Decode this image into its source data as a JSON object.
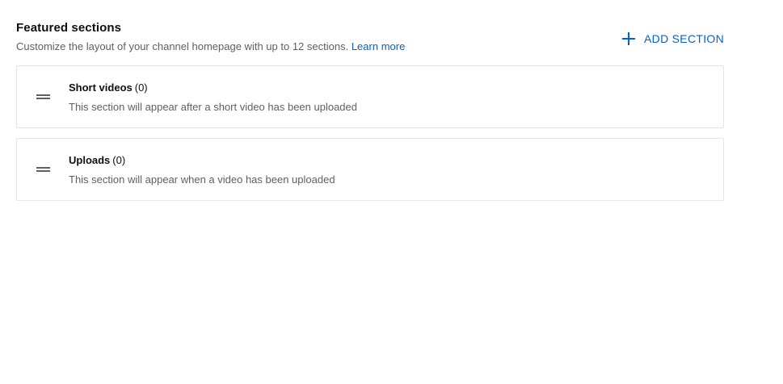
{
  "header": {
    "title": "Featured sections",
    "subtitle": "Customize the layout of your channel homepage with up to 12 sections.",
    "learn_more": "Learn more",
    "add_section_label": "ADD SECTION",
    "add_icon": "plus-icon"
  },
  "colors": {
    "accent": "#065fd4",
    "secondary_text": "#606060",
    "border": "#e5e5e5"
  },
  "sections": [
    {
      "name": "Short videos",
      "count": "(0)",
      "description": "This section will appear after a short video has been uploaded",
      "handle_icon": "drag-handle-icon"
    },
    {
      "name": "Uploads",
      "count": "(0)",
      "description": "This section will appear when a video has been uploaded",
      "handle_icon": "drag-handle-icon"
    }
  ]
}
